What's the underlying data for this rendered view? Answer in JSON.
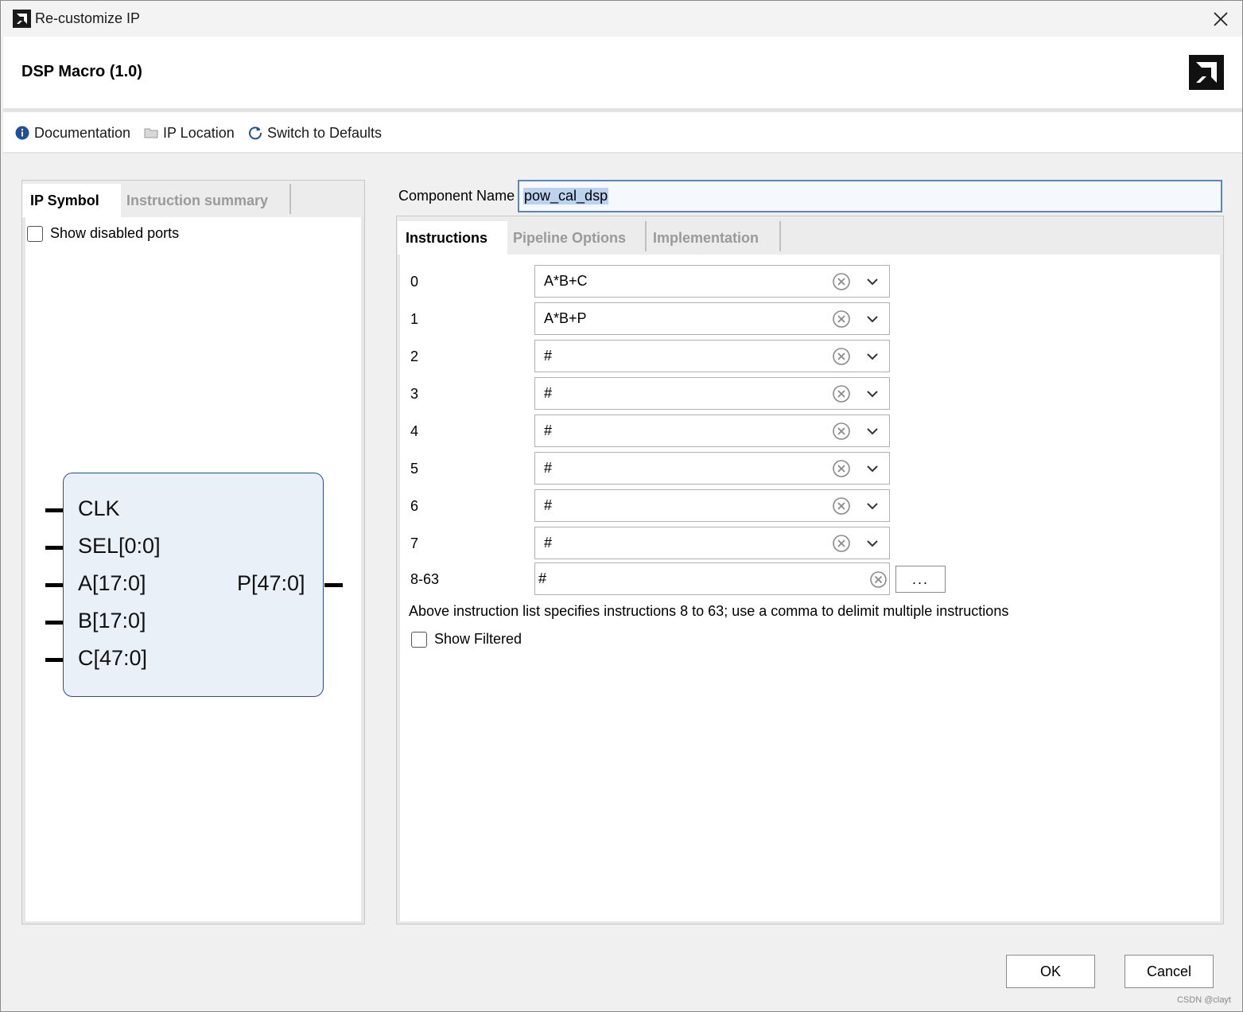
{
  "window": {
    "title": "Re-customize IP"
  },
  "header": {
    "ip_title": "DSP Macro (1.0)"
  },
  "toolbar": {
    "documentation": "Documentation",
    "ip_location": "IP Location",
    "switch_defaults": "Switch to Defaults"
  },
  "left": {
    "tabs": [
      "IP Symbol",
      "Instruction summary"
    ],
    "show_disabled_ports": "Show disabled ports",
    "symbol": {
      "inputs": [
        "CLK",
        "SEL[0:0]",
        "A[17:0]",
        "B[17:0]",
        "C[47:0]"
      ],
      "output": "P[47:0]"
    }
  },
  "component": {
    "label": "Component Name",
    "value": "pow_cal_dsp"
  },
  "right": {
    "tabs": [
      "Instructions",
      "Pipeline Options",
      "Implementation"
    ],
    "instructions": [
      {
        "index": "0",
        "value": "A*B+C"
      },
      {
        "index": "1",
        "value": "A*B+P"
      },
      {
        "index": "2",
        "value": "#"
      },
      {
        "index": "3",
        "value": "#"
      },
      {
        "index": "4",
        "value": "#"
      },
      {
        "index": "5",
        "value": "#"
      },
      {
        "index": "6",
        "value": "#"
      },
      {
        "index": "7",
        "value": "#"
      }
    ],
    "range": {
      "label": "8-63",
      "value": "#",
      "button": "..."
    },
    "note": "Above instruction list specifies instructions 8 to 63; use a comma to delimit multiple instructions",
    "show_filtered": "Show Filtered"
  },
  "footer": {
    "ok": "OK",
    "cancel": "Cancel"
  },
  "watermark": "CSDN @clayt",
  "colors": {
    "accent_border": "#5b84c4",
    "symbol_fill": "#e9f0f8",
    "symbol_border": "#2b4f8a"
  }
}
